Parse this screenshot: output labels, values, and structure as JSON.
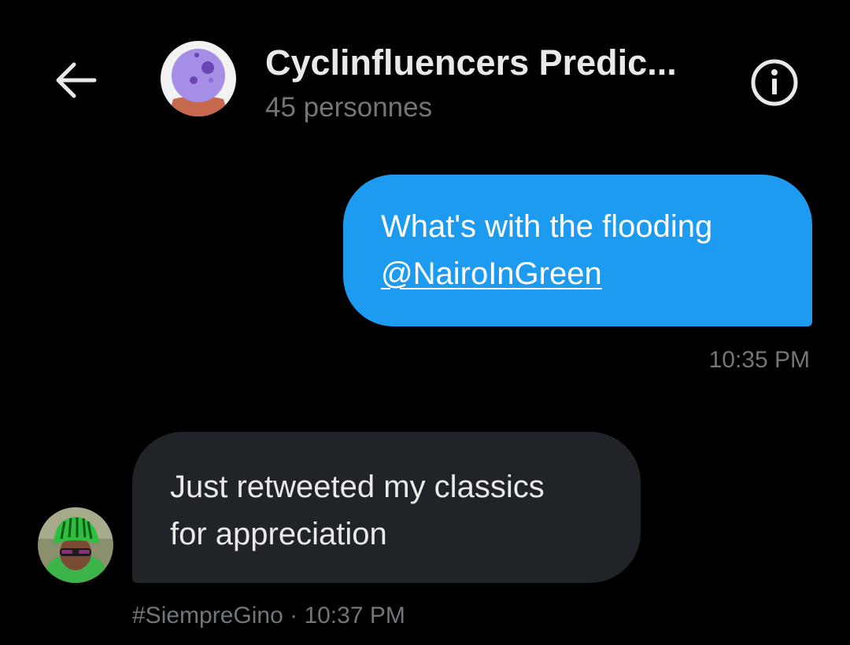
{
  "header": {
    "back_icon": "arrow-left-icon",
    "group_avatar_icon": "crystal-ball-icon",
    "title": "Cyclinfluencers Predic...",
    "subtitle": "45 personnes",
    "info_icon": "info-circle-icon"
  },
  "messages": [
    {
      "direction": "sent",
      "line1": "What's with the flooding",
      "mention": "@NairoInGreen",
      "time": "10:35 PM",
      "bubble_color": "#1d9bf0"
    },
    {
      "direction": "received",
      "line1": "Just retweeted my classics",
      "line2": "for appreciation",
      "sender": "#SiempreGino",
      "separator": " · ",
      "time": "10:37 PM",
      "bubble_color": "#202327",
      "avatar_icon": "cyclist-avatar"
    }
  ],
  "colors": {
    "background": "#000000",
    "primary_text": "#e7e9ea",
    "secondary_text": "#71767b",
    "accent": "#1d9bf0"
  }
}
